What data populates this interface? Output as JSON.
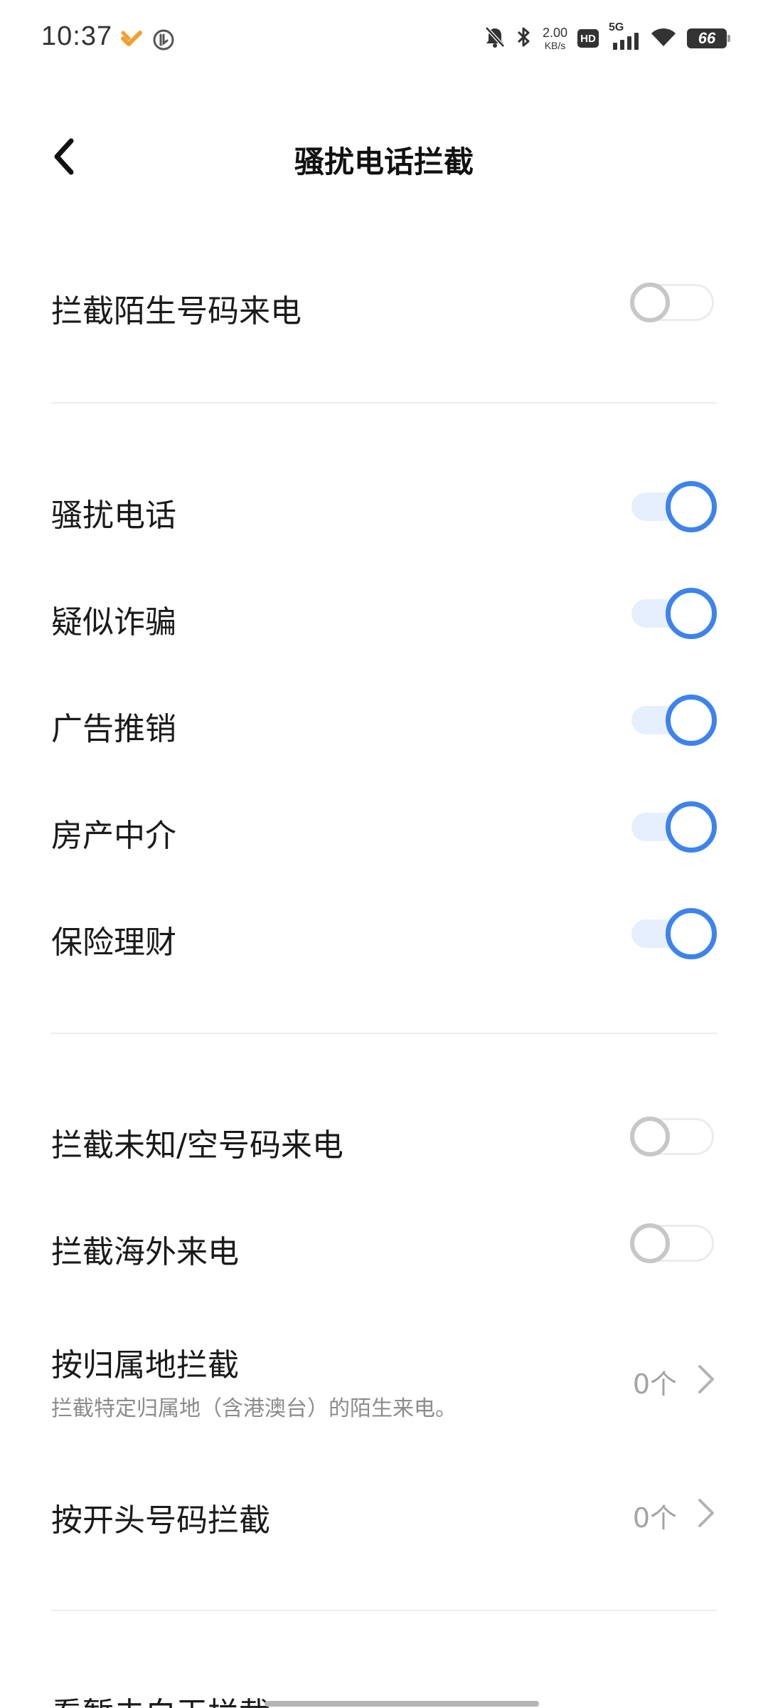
{
  "status_bar": {
    "time": "10:37",
    "net_speed_value": "2.00",
    "net_speed_unit": "KB/s",
    "hd_label": "HD",
    "signal_label": "5G",
    "battery": "66",
    "left_icons": [
      "app-notification-icon",
      "accessibility-icon"
    ],
    "right_icons": [
      "mute-bell-icon",
      "bluetooth-icon",
      "signal-icon",
      "wifi-icon",
      "battery-icon"
    ]
  },
  "header": {
    "title": "骚扰电话拦截",
    "back_icon": "chevron-left-icon"
  },
  "section1": {
    "unknown_callers": {
      "label": "拦截陌生号码来电",
      "enabled": false
    }
  },
  "section2": {
    "items": [
      {
        "label": "骚扰电话",
        "enabled": true
      },
      {
        "label": "疑似诈骗",
        "enabled": true
      },
      {
        "label": "广告推销",
        "enabled": true
      },
      {
        "label": "房产中介",
        "enabled": true
      },
      {
        "label": "保险理财",
        "enabled": true
      }
    ]
  },
  "section3": {
    "unknown_empty": {
      "label": "拦截未知/空号码来电",
      "enabled": false
    },
    "overseas": {
      "label": "拦截海外来电",
      "enabled": false
    },
    "by_region": {
      "label": "按归属地拦截",
      "sub": "拦截特定归属地（含港澳台）的陌生来电。",
      "value": "0个"
    },
    "by_prefix": {
      "label": "按开头号码拦截",
      "value": "0个"
    }
  },
  "truncated_next_row": "看暂未白王拦截",
  "colors": {
    "accent": "#3d83ee",
    "accent_track": "#e6effd",
    "off_knob": "#c7c7c7",
    "divider": "#ededed",
    "secondary_text": "#8c8c8c"
  }
}
